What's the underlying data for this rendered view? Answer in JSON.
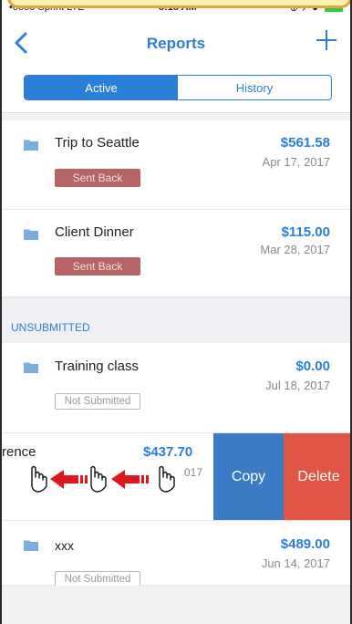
{
  "status_bar": {
    "carrier": "•oooo Sprint  LTE",
    "time": "8:18 AM",
    "right": "⊕ ↗ ● "
  },
  "navbar": {
    "title": "Reports",
    "back_icon": "chevron-left-icon",
    "add_icon": "plus-icon"
  },
  "segments": [
    {
      "label": "Active",
      "active": true
    },
    {
      "label": "History",
      "active": false
    }
  ],
  "active_reports": [
    {
      "title": "Trip to Seattle",
      "amount": "$561.58",
      "date": "Apr 17, 2017",
      "status": "Sent Back"
    },
    {
      "title": "Client Dinner",
      "amount": "$115.00",
      "date": "Mar 28, 2017",
      "status": "Sent Back"
    }
  ],
  "unsubmitted_header": "UNSUBMITTED",
  "unsubmitted_reports": [
    {
      "title": "Training class",
      "amount": "$0.00",
      "date": "Jul 18, 2017",
      "status": "Not Submitted"
    },
    {
      "title": "rence",
      "amount": "$437.70",
      "date": "017"
    },
    {
      "title": "xxx",
      "amount": "$489.00",
      "date": "Jun 14, 2017",
      "status": "Not Submitted"
    }
  ],
  "swipe_actions": {
    "copy": "Copy",
    "delete": "Delete"
  },
  "colors": {
    "accent": "#2a7fd8",
    "sent_back": "#b66565",
    "copy": "#3b7bc5",
    "delete": "#e05543",
    "arrow": "#e0161d",
    "callout_fill": "#fcf3b0",
    "callout_border": "#e2a53a"
  }
}
